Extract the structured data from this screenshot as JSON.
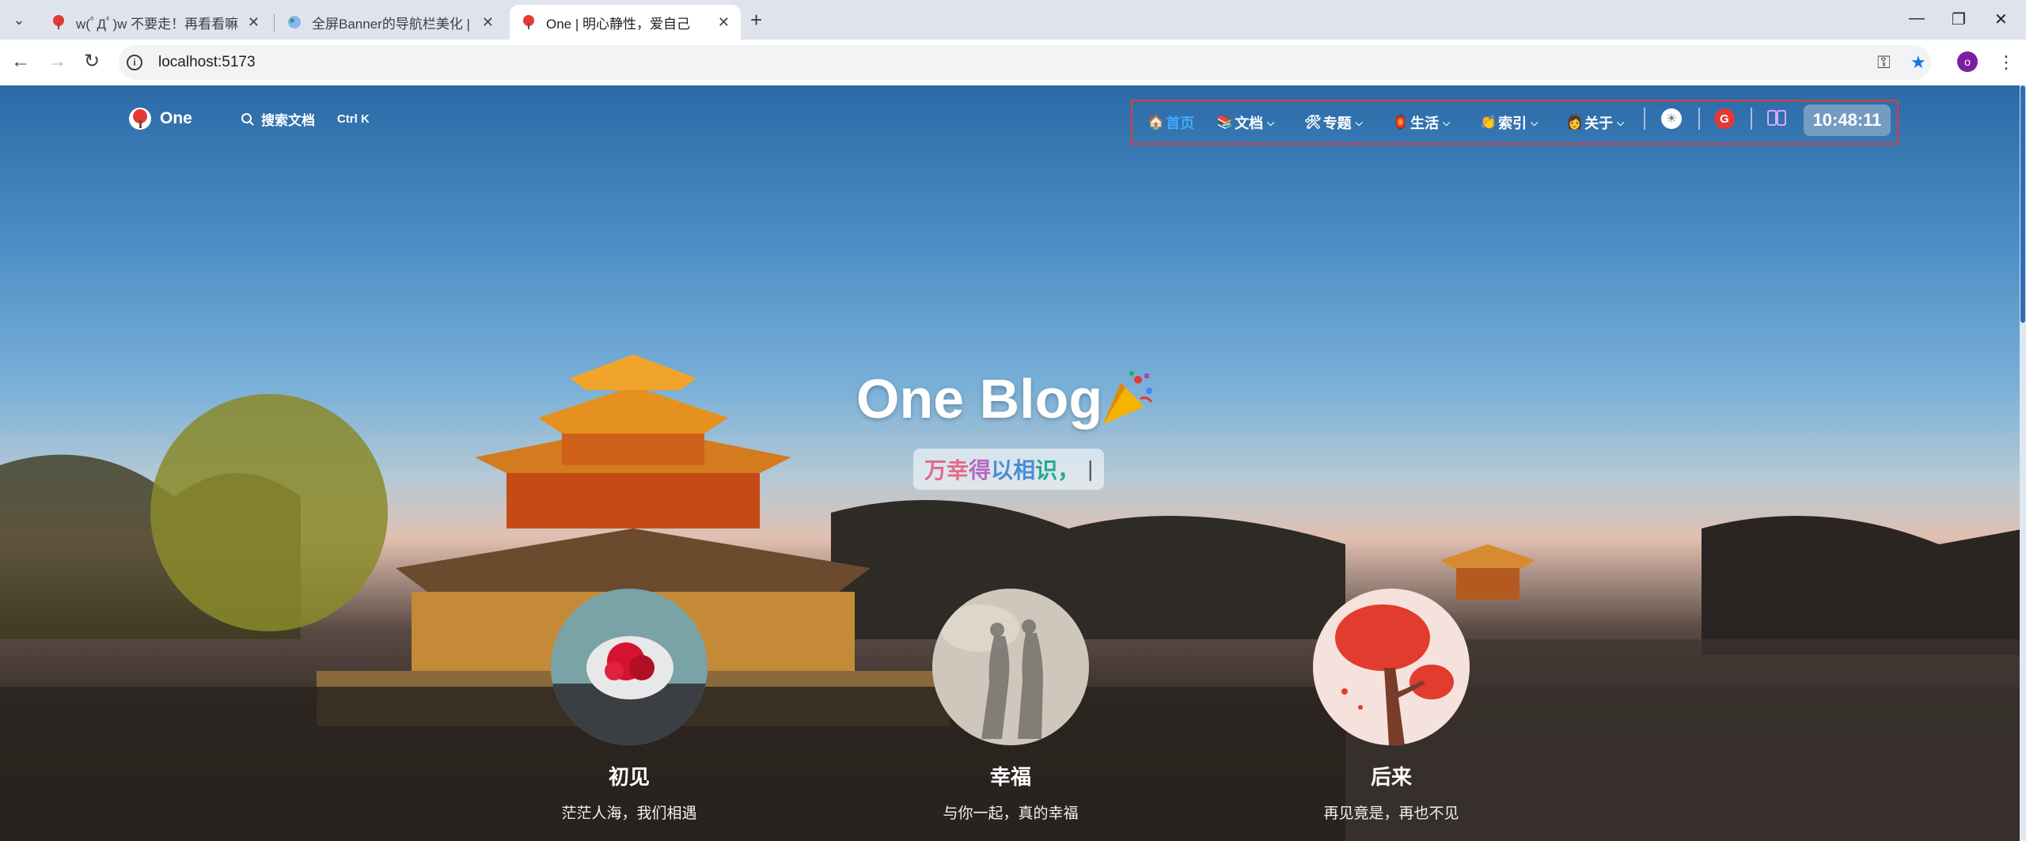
{
  "browser": {
    "tabs": [
      {
        "title": "w(ﾟДﾟ)w 不要走！再看看嘛！",
        "active": false
      },
      {
        "title": "全屏Banner的导航栏美化 | [白",
        "active": false
      },
      {
        "title": "One | 明心静性，爱自己",
        "active": true
      }
    ],
    "url": "localhost:5173",
    "profile_initial": "o"
  },
  "site": {
    "logo_text": "One",
    "search_label": "搜索文档",
    "search_shortcut": "Ctrl K",
    "nav": [
      {
        "emoji": "🏠",
        "label": "首页",
        "active": true,
        "dropdown": false
      },
      {
        "emoji": "📚",
        "label": "文档",
        "active": false,
        "dropdown": true
      },
      {
        "emoji": "🛠",
        "label": "专题",
        "active": false,
        "dropdown": true
      },
      {
        "emoji": "🏮",
        "label": "生活",
        "active": false,
        "dropdown": true
      },
      {
        "emoji": "👏",
        "label": "索引",
        "active": false,
        "dropdown": true
      },
      {
        "emoji": "👩",
        "label": "关于",
        "active": false,
        "dropdown": true
      }
    ],
    "clock": "10:48:11",
    "accent_color": "#3da9fc",
    "highlight_border_color": "#e53935"
  },
  "hero": {
    "title": "One Blog",
    "motto_chars": [
      "万",
      "幸",
      "得",
      "以",
      "相",
      "识",
      "，"
    ],
    "caret": "|"
  },
  "cards": [
    {
      "title": "初见",
      "desc": "茫茫人海，我们相遇"
    },
    {
      "title": "幸福",
      "desc": "与你一起，真的幸福"
    },
    {
      "title": "后来",
      "desc": "再见竟是，再也不见"
    }
  ]
}
